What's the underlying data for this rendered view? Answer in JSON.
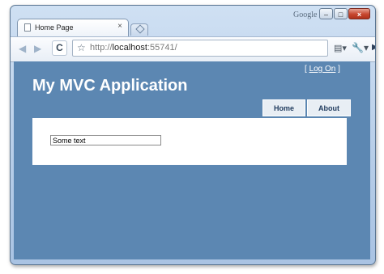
{
  "browser": {
    "brand": "Google",
    "tab": {
      "title": "Home Page"
    },
    "address": {
      "scheme": "http://",
      "host": "localhost",
      "path": ":55741/"
    }
  },
  "page": {
    "login": {
      "open_bracket": "[",
      "link": "Log On",
      "close_bracket": "]"
    },
    "title": "My MVC Application",
    "menu": [
      {
        "label": "Home"
      },
      {
        "label": "About"
      }
    ],
    "input": {
      "value": "Some text"
    }
  },
  "colors": {
    "page_background": "#5c87b2",
    "content_background": "#ffffff"
  },
  "icons": [
    "page-icon",
    "close-icon",
    "new-tab-icon",
    "back-icon",
    "forward-icon",
    "reload-icon",
    "bookmark-star-icon",
    "go-icon",
    "page-menu-icon",
    "wrench-icon",
    "minimize-icon",
    "maximize-icon",
    "window-close-icon"
  ]
}
